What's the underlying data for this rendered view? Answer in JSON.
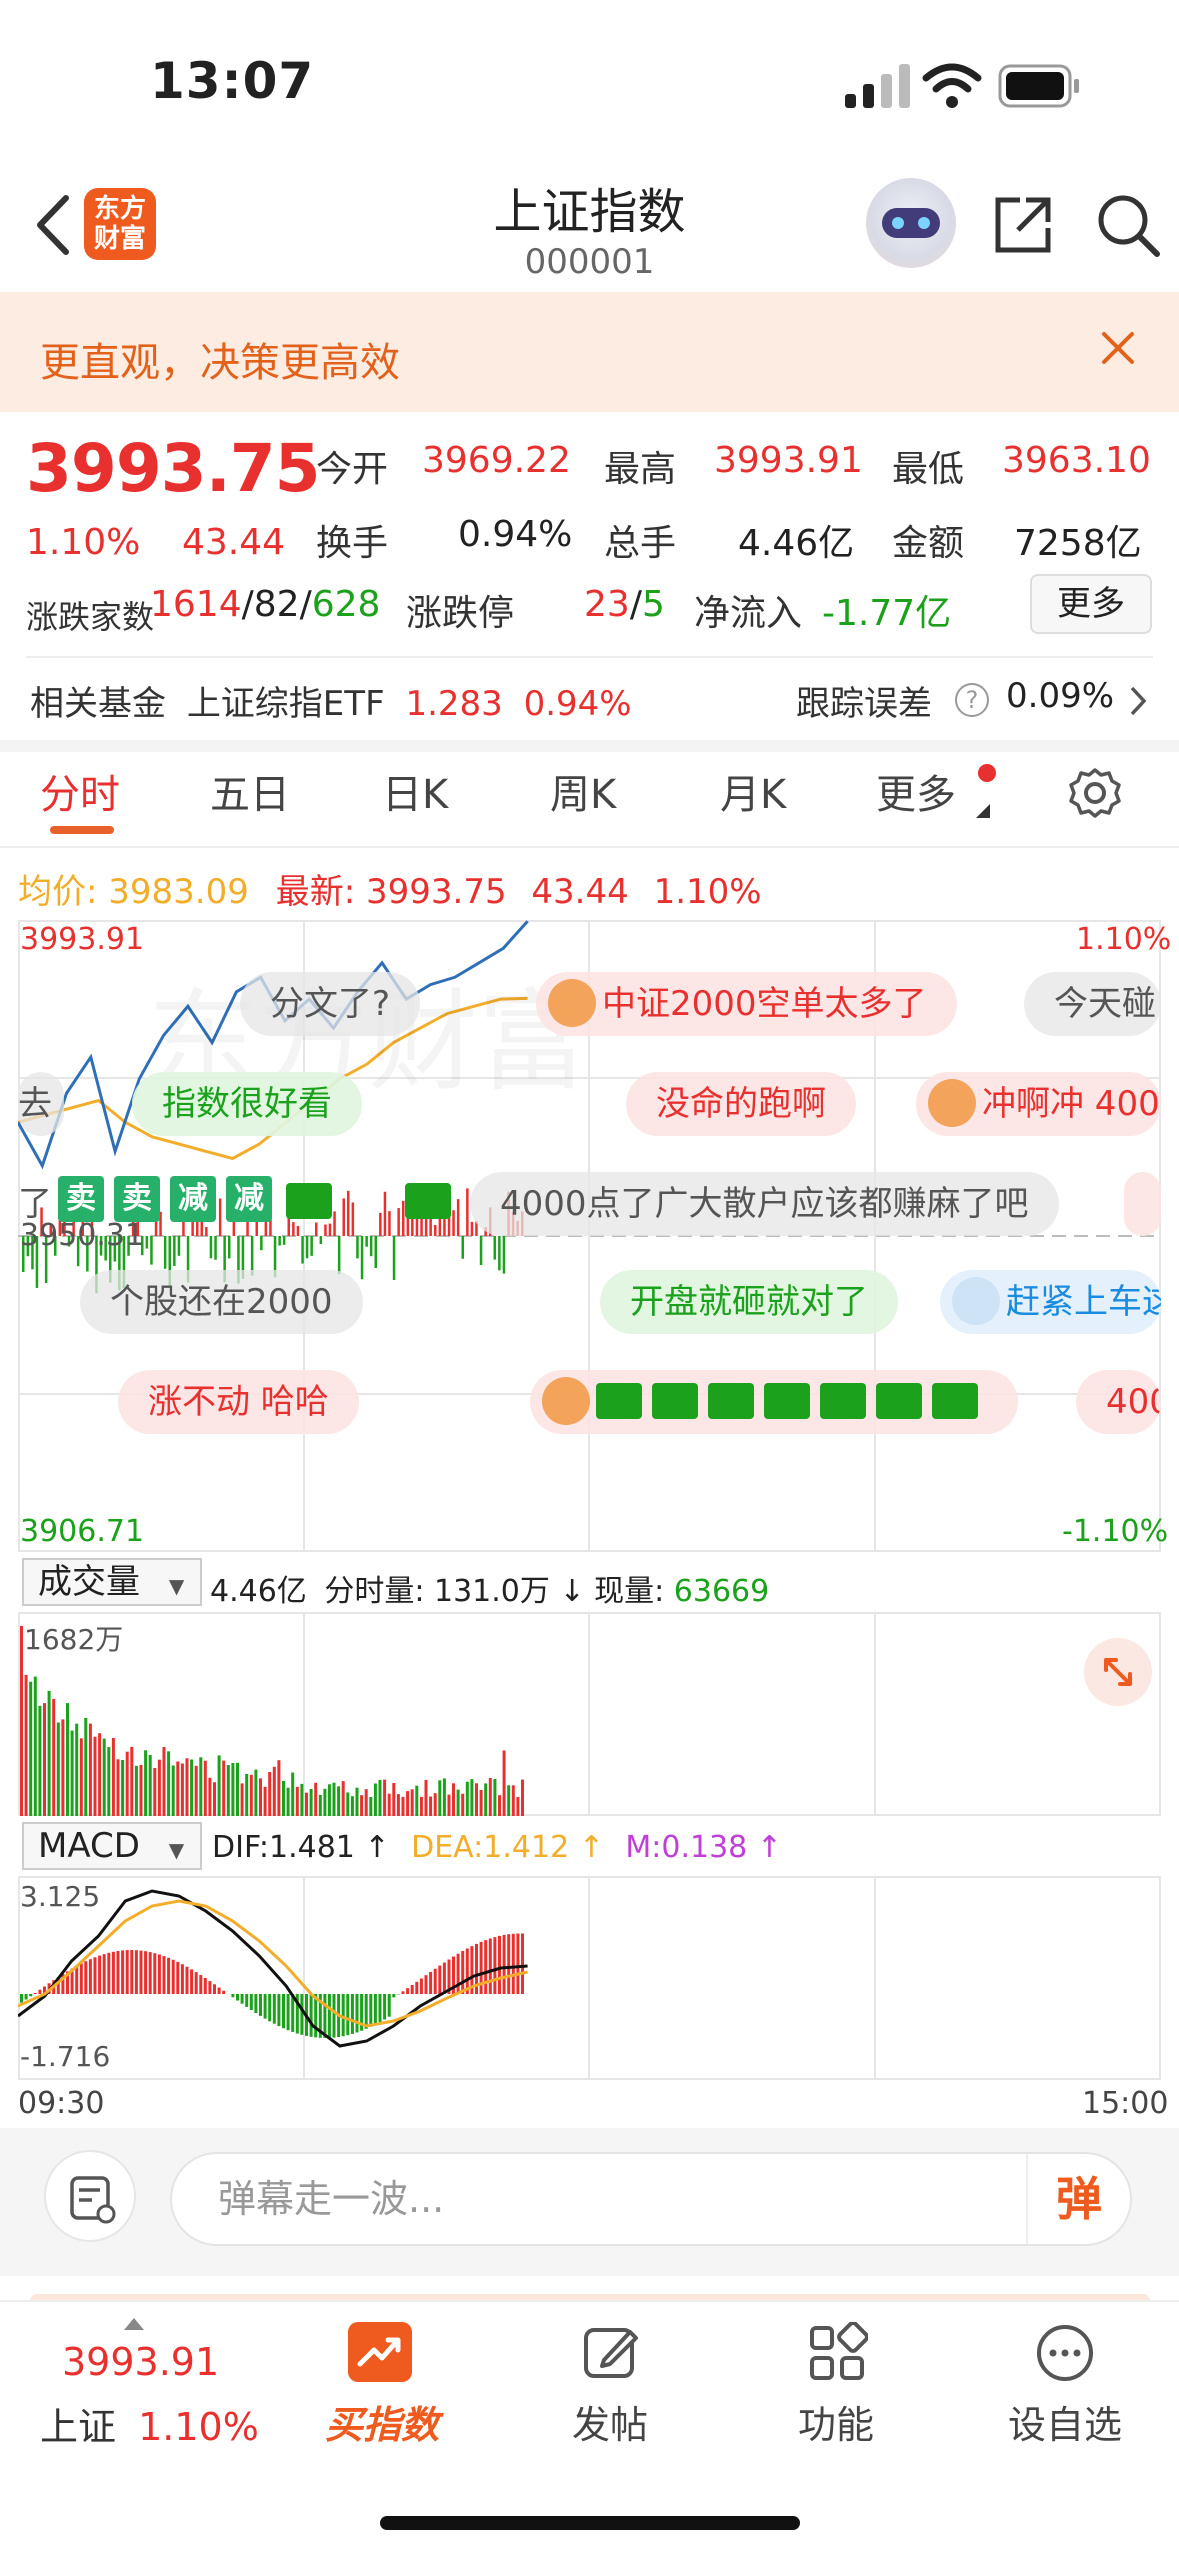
{
  "status_bar": {
    "time": "13:07"
  },
  "header": {
    "logo_line1": "东方",
    "logo_line2": "财富",
    "title": "上证指数",
    "code": "000001"
  },
  "banner": {
    "text": "更直观，决策更高效"
  },
  "quote": {
    "price": "3993.75",
    "change_pct": "1.10%",
    "change": "43.44",
    "open_label": "今开",
    "open": "3969.22",
    "high_label": "最高",
    "high": "3993.91",
    "low_label": "最低",
    "low": "3963.10",
    "turnover_label": "换手",
    "turnover": "0.94%",
    "volume_label": "总手",
    "volume": "4.46亿",
    "amount_label": "金额",
    "amount": "7258亿",
    "breadth_label": "涨跌家数",
    "breadth_up": "1614",
    "breadth_flat": "82",
    "breadth_down": "628",
    "limit_label": "涨跌停",
    "limit_up": "23",
    "limit_down": "5",
    "inflow_label": "净流入",
    "inflow": "-1.77亿",
    "more_button": "更多"
  },
  "fund": {
    "label": "相关基金",
    "name": "上证综指ETF",
    "price": "1.283",
    "pct": "0.94%",
    "tracking_label": "跟踪误差",
    "tracking": "0.09%"
  },
  "tabs": [
    "分时",
    "五日",
    "日K",
    "周K",
    "月K",
    "更多"
  ],
  "chart_header": {
    "avg_label": "均价:",
    "avg": "3983.09",
    "latest_label": "最新:",
    "latest": "3993.75",
    "change": "43.44",
    "pct": "1.10%"
  },
  "axis": {
    "top_price": "3993.91",
    "mid_price": "3950.31",
    "bottom_price": "3906.71",
    "top_pct": "1.10%",
    "bottom_pct": "-1.10%"
  },
  "danmu": {
    "d1": "分文了?",
    "d2": "中证2000空单太多了",
    "d3": "今天碰",
    "d4": "去",
    "d5": "指数很好看",
    "d6": "没命的跑啊",
    "d7": "冲啊冲 400",
    "d8": "了",
    "d9": "4000点了广大散户应该都赚麻了吧",
    "d10": "个股还在2000",
    "d11": "开盘就砸就对了",
    "d12": "赶紧上车这",
    "d13": "涨不动 哈哈",
    "d14": "400",
    "badge_sell": "卖",
    "badge_cut": "减"
  },
  "volume_panel": {
    "selector": "成交量",
    "total": "4.46亿",
    "per_label": "分时量:",
    "per_value": "131.0万",
    "now_label": "现量:",
    "now_value": "63669",
    "max_label": "1682万"
  },
  "macd_panel": {
    "selector": "MACD",
    "dif": "DIF:1.481",
    "dea": "DEA:1.412",
    "m": "M:0.138",
    "top": "3.125",
    "bottom": "-1.716"
  },
  "time_axis": {
    "start": "09:30",
    "end": "15:00"
  },
  "danmu_input": {
    "placeholder": "弹幕走一波...",
    "send": "弹"
  },
  "bottom_nav": {
    "price": "3993.91",
    "index_name": "上证",
    "index_pct": "1.10%",
    "items": [
      "买指数",
      "发帖",
      "功能",
      "设自选"
    ]
  },
  "colors": {
    "up": "#e8302f",
    "down": "#1ba11b",
    "accent": "#ef5a1f",
    "price_line": "#2f6fb7",
    "avg_line": "#f2ad2a"
  },
  "chart_data": [
    {
      "type": "line",
      "title": "分时",
      "series": [
        {
          "values": [
            3966,
            3960,
            3970,
            3975,
            3962,
            3972,
            3978,
            3982,
            3977,
            3984,
            3986,
            3980,
            3983,
            3979,
            3984,
            3988,
            3983,
            3985,
            3986,
            3988,
            3990,
            3993.75
          ]
        },
        {
          "values": [
            3966,
            3967,
            3968,
            3969,
            3966,
            3964,
            3963,
            3962,
            3961,
            3963,
            3966,
            3969,
            3972,
            3974,
            3977,
            3979,
            3981,
            3982,
            3983,
            3983.09
          ]
        }
      ],
      "ylim": [
        3906.71,
        3993.91
      ]
    },
    {
      "type": "bar",
      "title": "成交量",
      "ylabel": "1682万"
    },
    {
      "type": "line",
      "title": "MACD",
      "ylim": [
        -1.716,
        3.125
      ]
    }
  ]
}
